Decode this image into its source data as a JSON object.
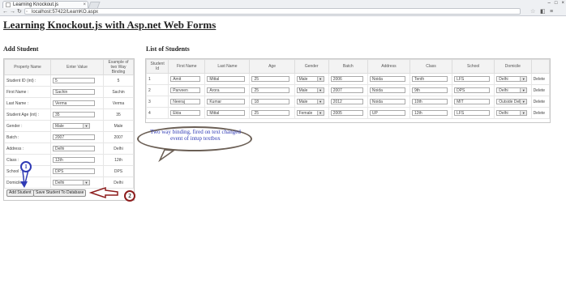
{
  "browser": {
    "tab_title": "Learning Knockout.js",
    "address": "localhost:57422/LearnKO.aspx"
  },
  "page_title": "Learning Knockout.js with Asp.net Web Forms",
  "add_student": {
    "heading": "Add Student",
    "columns": [
      "Property Name",
      "Enter Value",
      "Example of two Way Binding"
    ],
    "rows": [
      {
        "label": "Student ID (int) :",
        "value": "5",
        "echo": "5",
        "control": "input"
      },
      {
        "label": "First Name :",
        "value": "Sachin",
        "echo": "Sachin",
        "control": "input"
      },
      {
        "label": "Last Name :",
        "value": "Verma",
        "echo": "Verma",
        "control": "input"
      },
      {
        "label": "Student Age (int) :",
        "value": "35",
        "echo": "35",
        "control": "input"
      },
      {
        "label": "Gender :",
        "value": "Male",
        "echo": "Male",
        "control": "select"
      },
      {
        "label": "Batch :",
        "value": "2007",
        "echo": "2007",
        "control": "input"
      },
      {
        "label": "Address :",
        "value": "Delhi",
        "echo": "Delhi",
        "control": "input"
      },
      {
        "label": "Class :",
        "value": "12th",
        "echo": "12th",
        "control": "input"
      },
      {
        "label": "School :",
        "value": "DPS",
        "echo": "DPS",
        "control": "input"
      },
      {
        "label": "Domicile :",
        "value": "Delhi",
        "echo": "Delhi",
        "control": "select"
      }
    ],
    "add_button": "Add Student",
    "save_button": "Save Student To Database"
  },
  "list_students": {
    "heading": "List of Students",
    "columns": [
      "Student Id",
      "First Name",
      "Last Name",
      "Age",
      "Gender",
      "Batch",
      "Address",
      "Class",
      "School",
      "Domicile",
      ""
    ],
    "rows": [
      {
        "id": "1",
        "first": "Amit",
        "last": "Mittal",
        "age": "25",
        "gender": "Male",
        "batch": "2006",
        "address": "Noida",
        "class": "Tenth",
        "school": "LFS",
        "domicile": "Delhi",
        "action": "Delete"
      },
      {
        "id": "2",
        "first": "Parveen",
        "last": "Arora",
        "age": "25",
        "gender": "Male",
        "batch": "2007",
        "address": "Noida",
        "class": "9th",
        "school": "DPS",
        "domicile": "Delhi",
        "action": "Delete"
      },
      {
        "id": "3",
        "first": "Neeraj",
        "last": "Kumar",
        "age": "18",
        "gender": "Male",
        "batch": "2012",
        "address": "Noida",
        "class": "10th",
        "school": "MIT",
        "domicile": "Outside Delhi",
        "action": "Delete"
      },
      {
        "id": "4",
        "first": "Ekta",
        "last": "Mittal",
        "age": "25",
        "gender": "Female",
        "batch": "2005",
        "address": "UP",
        "class": "12th",
        "school": "LFS",
        "domicile": "Delhi",
        "action": "Delete"
      }
    ]
  },
  "annotations": {
    "callout": "Two way binding, fired on text changed event of intup textbox",
    "marker1": "1",
    "marker2": "2"
  },
  "colors": {
    "annotation_blue": "#2f3ab5",
    "annotation_red": "#8d1d1d"
  }
}
